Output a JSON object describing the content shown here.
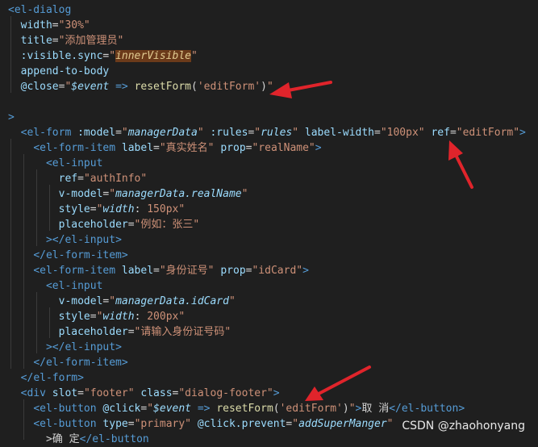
{
  "editor": {
    "watermark": "CSDN @zhaohonyang",
    "accent_color": "#e0242b",
    "lines": [
      [
        [
          "<",
          "tag"
        ],
        [
          "el-dialog",
          "tag"
        ]
      ],
      [
        [
          "  ",
          ""
        ],
        [
          "width",
          "attr"
        ],
        [
          "=",
          ""
        ],
        [
          "\"30%\"",
          "str"
        ]
      ],
      [
        [
          "  ",
          ""
        ],
        [
          "title",
          "attr"
        ],
        [
          "=",
          ""
        ],
        [
          "\"添加管理员\"",
          "str"
        ]
      ],
      [
        [
          "  ",
          ""
        ],
        [
          ":visible.sync",
          "attr"
        ],
        [
          "=",
          ""
        ],
        [
          "\"",
          "str"
        ],
        [
          "innerVisible",
          "hl"
        ],
        [
          "\"",
          "str"
        ]
      ],
      [
        [
          "  ",
          ""
        ],
        [
          "append-to-body",
          "attr"
        ]
      ],
      [
        [
          "  ",
          ""
        ],
        [
          "@close",
          "attr"
        ],
        [
          "=",
          ""
        ],
        [
          "\"",
          "str"
        ],
        [
          "$event",
          "ital"
        ],
        [
          " ",
          ""
        ],
        [
          "=>",
          "kw"
        ],
        [
          " ",
          ""
        ],
        [
          "resetForm",
          "fn"
        ],
        [
          "(",
          ""
        ],
        [
          "'editForm'",
          "str"
        ],
        [
          ")",
          ""
        ],
        [
          "\"",
          "str"
        ]
      ],
      [],
      [
        [
          ">",
          "tag"
        ]
      ],
      [
        [
          "  ",
          ""
        ],
        [
          "<",
          "tag"
        ],
        [
          "el-form",
          "tag"
        ],
        [
          " ",
          ""
        ],
        [
          ":model",
          "attr"
        ],
        [
          "=",
          ""
        ],
        [
          "\"",
          "str"
        ],
        [
          "managerData",
          "ital"
        ],
        [
          "\"",
          "str"
        ],
        [
          " ",
          ""
        ],
        [
          ":rules",
          "attr"
        ],
        [
          "=",
          ""
        ],
        [
          "\"",
          "str"
        ],
        [
          "rules",
          "ital"
        ],
        [
          "\"",
          "str"
        ],
        [
          " ",
          ""
        ],
        [
          "label-width",
          "attr"
        ],
        [
          "=",
          ""
        ],
        [
          "\"100px\"",
          "str"
        ],
        [
          " ",
          ""
        ],
        [
          "ref",
          "attr"
        ],
        [
          "=",
          ""
        ],
        [
          "\"editForm\"",
          "str"
        ],
        [
          ">",
          "tag"
        ]
      ],
      [
        [
          "    ",
          ""
        ],
        [
          "<",
          "tag"
        ],
        [
          "el-form-item",
          "tag"
        ],
        [
          " ",
          ""
        ],
        [
          "label",
          "attr"
        ],
        [
          "=",
          ""
        ],
        [
          "\"真实姓名\"",
          "str"
        ],
        [
          " ",
          ""
        ],
        [
          "prop",
          "attr"
        ],
        [
          "=",
          ""
        ],
        [
          "\"realName\"",
          "str"
        ],
        [
          ">",
          "tag"
        ]
      ],
      [
        [
          "      ",
          ""
        ],
        [
          "<",
          "tag"
        ],
        [
          "el-input",
          "tag"
        ]
      ],
      [
        [
          "        ",
          ""
        ],
        [
          "ref",
          "attr"
        ],
        [
          "=",
          ""
        ],
        [
          "\"authInfo\"",
          "str"
        ]
      ],
      [
        [
          "        ",
          ""
        ],
        [
          "v-model",
          "attr"
        ],
        [
          "=",
          ""
        ],
        [
          "\"",
          "str"
        ],
        [
          "managerData.realName",
          "ital"
        ],
        [
          "\"",
          "str"
        ]
      ],
      [
        [
          "        ",
          ""
        ],
        [
          "style",
          "attr"
        ],
        [
          "=",
          ""
        ],
        [
          "\"",
          "str"
        ],
        [
          "width",
          "ital"
        ],
        [
          ": ",
          ""
        ],
        [
          "150px",
          "str"
        ],
        [
          "\"",
          "str"
        ]
      ],
      [
        [
          "        ",
          ""
        ],
        [
          "placeholder",
          "attr"
        ],
        [
          "=",
          ""
        ],
        [
          "\"例如：张三\"",
          "str"
        ]
      ],
      [
        [
          "      ",
          ""
        ],
        [
          "></",
          "tag"
        ],
        [
          "el-input",
          "tag"
        ],
        [
          ">",
          "tag"
        ]
      ],
      [
        [
          "    ",
          ""
        ],
        [
          "</",
          "tag"
        ],
        [
          "el-form-item",
          "tag"
        ],
        [
          ">",
          "tag"
        ]
      ],
      [
        [
          "    ",
          ""
        ],
        [
          "<",
          "tag"
        ],
        [
          "el-form-item",
          "tag"
        ],
        [
          " ",
          ""
        ],
        [
          "label",
          "attr"
        ],
        [
          "=",
          ""
        ],
        [
          "\"身份证号\"",
          "str"
        ],
        [
          " ",
          ""
        ],
        [
          "prop",
          "attr"
        ],
        [
          "=",
          ""
        ],
        [
          "\"idCard\"",
          "str"
        ],
        [
          ">",
          "tag"
        ]
      ],
      [
        [
          "      ",
          ""
        ],
        [
          "<",
          "tag"
        ],
        [
          "el-input",
          "tag"
        ]
      ],
      [
        [
          "        ",
          ""
        ],
        [
          "v-model",
          "attr"
        ],
        [
          "=",
          ""
        ],
        [
          "\"",
          "str"
        ],
        [
          "managerData.idCard",
          "ital"
        ],
        [
          "\"",
          "str"
        ]
      ],
      [
        [
          "        ",
          ""
        ],
        [
          "style",
          "attr"
        ],
        [
          "=",
          ""
        ],
        [
          "\"",
          "str"
        ],
        [
          "width",
          "ital"
        ],
        [
          ": ",
          ""
        ],
        [
          "200px",
          "str"
        ],
        [
          "\"",
          "str"
        ]
      ],
      [
        [
          "        ",
          ""
        ],
        [
          "placeholder",
          "attr"
        ],
        [
          "=",
          ""
        ],
        [
          "\"请输入身份证号码\"",
          "str"
        ]
      ],
      [
        [
          "      ",
          ""
        ],
        [
          "></",
          "tag"
        ],
        [
          "el-input",
          "tag"
        ],
        [
          ">",
          "tag"
        ]
      ],
      [
        [
          "    ",
          ""
        ],
        [
          "</",
          "tag"
        ],
        [
          "el-form-item",
          "tag"
        ],
        [
          ">",
          "tag"
        ]
      ],
      [
        [
          "  ",
          ""
        ],
        [
          "</",
          "tag"
        ],
        [
          "el-form",
          "tag"
        ],
        [
          ">",
          "tag"
        ]
      ],
      [
        [
          "  ",
          ""
        ],
        [
          "<",
          "tag"
        ],
        [
          "div",
          "tag"
        ],
        [
          " ",
          ""
        ],
        [
          "slot",
          "attr"
        ],
        [
          "=",
          ""
        ],
        [
          "\"footer\"",
          "str"
        ],
        [
          " ",
          ""
        ],
        [
          "class",
          "attr"
        ],
        [
          "=",
          ""
        ],
        [
          "\"dialog-footer\"",
          "str"
        ],
        [
          ">",
          "tag"
        ]
      ],
      [
        [
          "    ",
          ""
        ],
        [
          "<",
          "tag"
        ],
        [
          "el-button",
          "tag"
        ],
        [
          " ",
          ""
        ],
        [
          "@click",
          "attr"
        ],
        [
          "=",
          ""
        ],
        [
          "\"",
          "str"
        ],
        [
          "$event",
          "ital"
        ],
        [
          " ",
          ""
        ],
        [
          "=>",
          "kw"
        ],
        [
          " ",
          ""
        ],
        [
          "resetForm",
          "fn"
        ],
        [
          "(",
          ""
        ],
        [
          "'editForm'",
          "str"
        ],
        [
          ")",
          ""
        ],
        [
          "\"",
          "str"
        ],
        [
          ">",
          "tag"
        ],
        [
          "取 消",
          ""
        ],
        [
          "</",
          "tag"
        ],
        [
          "el-button",
          "tag"
        ],
        [
          ">",
          "tag"
        ]
      ],
      [
        [
          "    ",
          ""
        ],
        [
          "<",
          "tag"
        ],
        [
          "el-button",
          "tag"
        ],
        [
          " ",
          ""
        ],
        [
          "type",
          "attr"
        ],
        [
          "=",
          ""
        ],
        [
          "\"primary\"",
          "str"
        ],
        [
          " ",
          ""
        ],
        [
          "@click.prevent",
          "attr"
        ],
        [
          "=",
          ""
        ],
        [
          "\"",
          "str"
        ],
        [
          "addSuperManger",
          "ital"
        ],
        [
          "\"",
          "str"
        ]
      ],
      [
        [
          "      ",
          ""
        ],
        [
          ">确 定",
          "pun"
        ],
        [
          "</",
          "tag"
        ],
        [
          "el-button",
          "tag"
        ]
      ]
    ]
  }
}
